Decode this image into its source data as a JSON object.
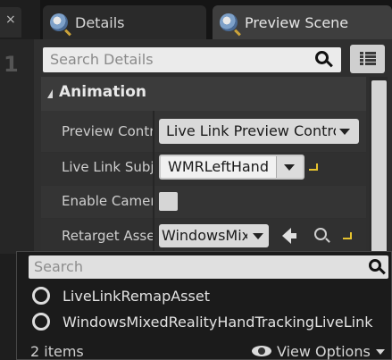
{
  "left_strip": {
    "close_glyph": "×",
    "digit": "1"
  },
  "tabs": [
    {
      "label": "Details",
      "icon": "details-icon",
      "active": false
    },
    {
      "label": "Preview Scene",
      "icon": "details-icon",
      "active": true
    }
  ],
  "details": {
    "search_placeholder": "Search Details",
    "category": "Animation",
    "properties": [
      {
        "label": "Preview Contr",
        "value": "Live Link Preview Contro"
      },
      {
        "label": "Live Link Subj",
        "value": "WMRLeftHand"
      },
      {
        "label": "Enable Camera",
        "checked": false
      },
      {
        "label": "Retarget Asset",
        "value": "WindowsMixe"
      }
    ]
  },
  "picker": {
    "search_placeholder": "Search",
    "items": [
      {
        "label": "LiveLinkRemapAsset"
      },
      {
        "label": "WindowsMixedRealityHandTrackingLiveLink"
      }
    ],
    "item_count": "2 items",
    "view_options": "View Options"
  },
  "colors": {
    "background": "#151515",
    "panel": "#2f2f2f",
    "active_tab": "#3e3e3e",
    "reset_yellow": "#e5c22e"
  }
}
